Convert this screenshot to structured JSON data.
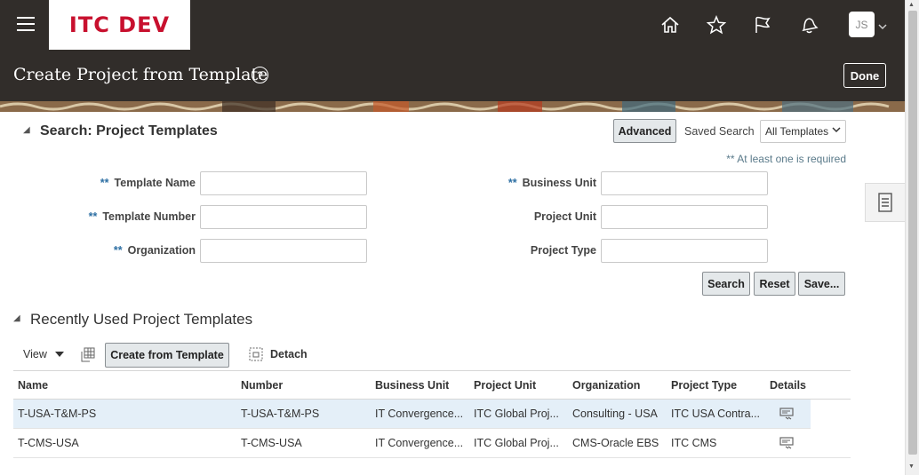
{
  "header": {
    "brand": "ITC DEV",
    "avatar_initials": "JS",
    "icons": [
      "home-icon",
      "favorites-star-icon",
      "watchlist-flag-icon",
      "notifications-bell-icon"
    ]
  },
  "title_bar": {
    "title": "Create Project from Template",
    "done_label": "Done"
  },
  "search": {
    "heading": "Search: Project Templates",
    "advanced_label": "Advanced",
    "saved_search_label": "Saved Search",
    "saved_search_value": "All Templates",
    "required_note": "** At least one is required",
    "required_mark": "**",
    "fields": {
      "template_name": "Template Name",
      "template_number": "Template Number",
      "organization": "Organization",
      "business_unit": "Business Unit",
      "project_unit": "Project Unit",
      "project_type": "Project Type"
    },
    "values": {
      "template_name": "",
      "template_number": "",
      "organization": "",
      "business_unit": "",
      "project_unit": "",
      "project_type": ""
    },
    "buttons": {
      "search": "Search",
      "reset": "Reset",
      "save": "Save..."
    }
  },
  "recent": {
    "heading": "Recently Used Project Templates",
    "view_label": "View",
    "create_label": "Create from Template",
    "detach_label": "Detach",
    "columns": [
      "Name",
      "Number",
      "Business Unit",
      "Project Unit",
      "Organization",
      "Project Type",
      "Details"
    ],
    "rows": [
      [
        "T-USA-T&M-PS",
        "T-USA-T&M-PS",
        "IT Convergence...",
        "ITC Global Proj...",
        "Consulting - USA",
        "ITC USA Contra..."
      ],
      [
        "T-CMS-USA",
        "T-CMS-USA",
        "IT Convergence...",
        "ITC Global Proj...",
        "CMS-Oracle EBS",
        "ITC CMS"
      ]
    ]
  },
  "colors": {
    "header_bg": "#312d2a",
    "brand_red": "#c8102e",
    "selected_row": "#e4eff8",
    "required_blue": "#2d6fa3"
  }
}
